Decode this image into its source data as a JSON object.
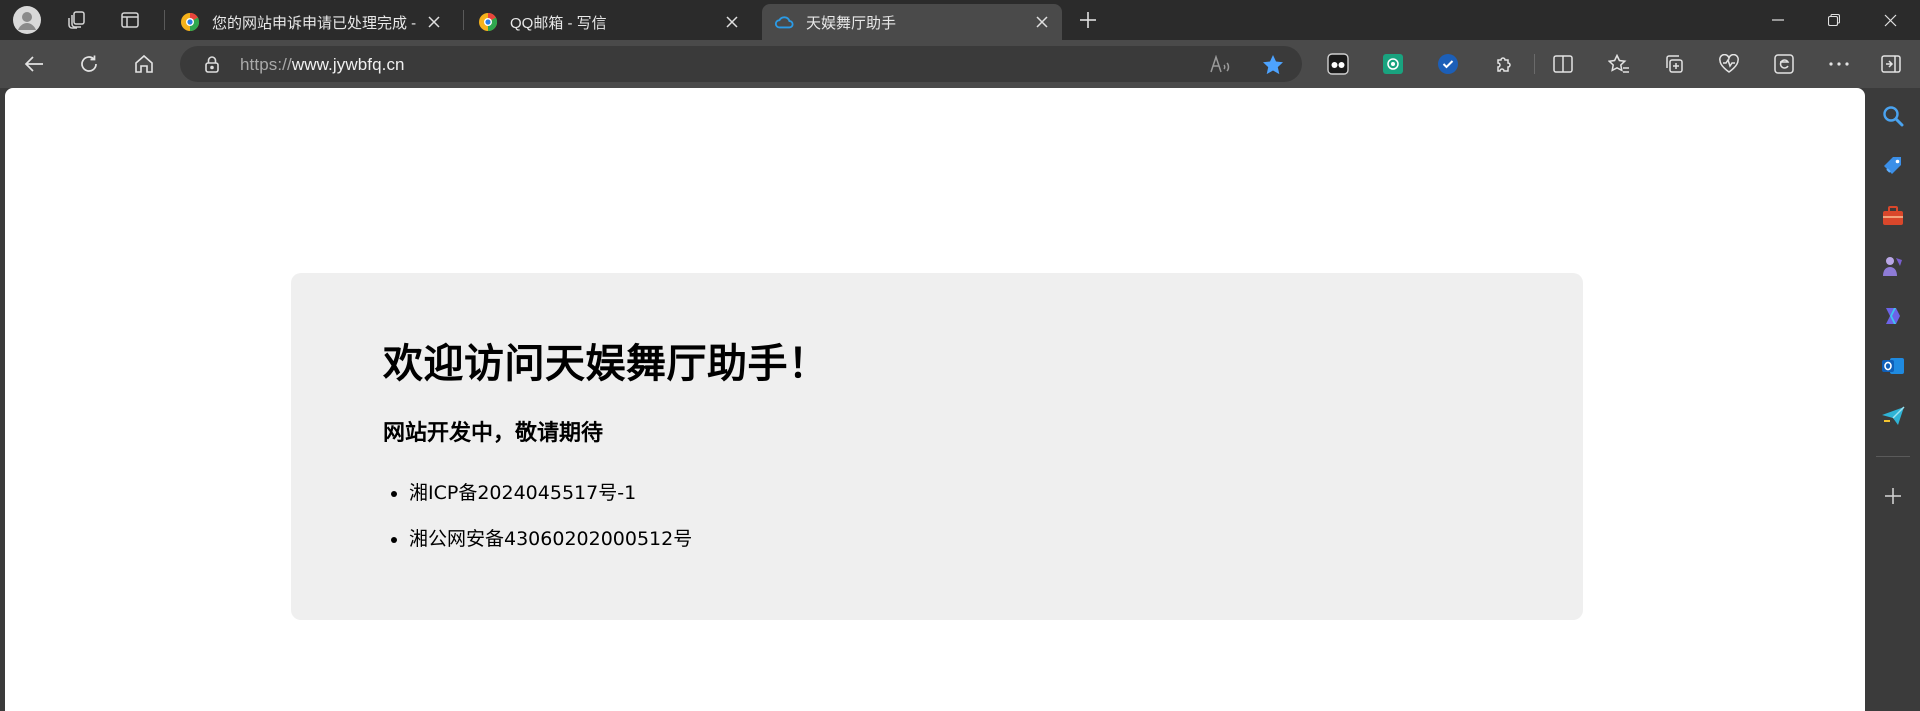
{
  "tabs": [
    {
      "title": "您的网站申诉申请已处理完成 - QQ邮箱",
      "favicon": "qq-mail-favicon",
      "active": false
    },
    {
      "title": "QQ邮箱 - 写信",
      "favicon": "qq-mail-favicon",
      "active": false
    },
    {
      "title": "天娱舞厅助手",
      "favicon": "cloud-favicon",
      "active": true
    }
  ],
  "address_bar": {
    "scheme": "https://",
    "host": "www.jywbfq.cn"
  },
  "page": {
    "heading": "欢迎访问天娱舞厅助手！",
    "subheading": "网站开发中，敬请期待",
    "items": [
      "湘ICP备2024045517号-1",
      "湘公网安备43060202000512号"
    ]
  },
  "colors": {
    "favorite_star": "#4da3ff",
    "card_background": "#efefef",
    "active_tab": "#4a4a4a"
  },
  "icons": {
    "toolbar": [
      "back-icon",
      "refresh-icon",
      "home-icon",
      "lock-icon",
      "read-aloud-icon",
      "favorite-star-icon",
      "extension-mask-icon",
      "extension-chatgpt-icon",
      "extension-shield-icon",
      "extensions-puzzle-icon",
      "split-screen-icon",
      "favorites-icon",
      "collections-icon",
      "browser-essentials-icon",
      "ie-mode-icon",
      "more-icon",
      "sidebar-toggle-icon"
    ],
    "sidebar": [
      "search-icon",
      "shopping-tag-icon",
      "tools-icon",
      "games-icon",
      "copilot-icon",
      "outlook-icon",
      "send-icon",
      "add-icon"
    ]
  }
}
